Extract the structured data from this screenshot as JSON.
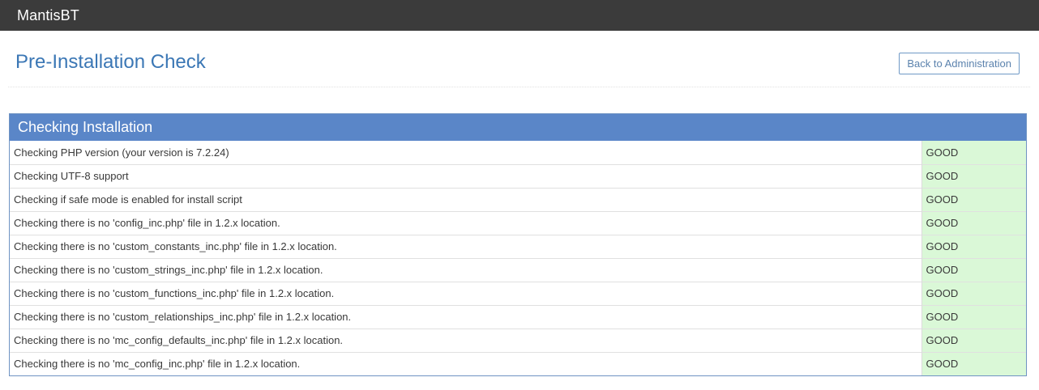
{
  "navbar": {
    "brand": "MantisBT"
  },
  "header": {
    "title": "Pre-Installation Check",
    "back_button": "Back to Administration"
  },
  "checks": {
    "title": "Checking Installation",
    "rows": [
      {
        "label": "Checking PHP version (your version is 7.2.24)",
        "status": "GOOD"
      },
      {
        "label": "Checking UTF-8 support",
        "status": "GOOD"
      },
      {
        "label": "Checking if safe mode is enabled for install script",
        "status": "GOOD"
      },
      {
        "label": "Checking there is no 'config_inc.php' file in 1.2.x location.",
        "status": "GOOD"
      },
      {
        "label": "Checking there is no 'custom_constants_inc.php' file in 1.2.x location.",
        "status": "GOOD"
      },
      {
        "label": "Checking there is no 'custom_strings_inc.php' file in 1.2.x location.",
        "status": "GOOD"
      },
      {
        "label": "Checking there is no 'custom_functions_inc.php' file in 1.2.x location.",
        "status": "GOOD"
      },
      {
        "label": "Checking there is no 'custom_relationships_inc.php' file in 1.2.x location.",
        "status": "GOOD"
      },
      {
        "label": "Checking there is no 'mc_config_defaults_inc.php' file in 1.2.x location.",
        "status": "GOOD"
      },
      {
        "label": "Checking there is no 'mc_config_inc.php' file in 1.2.x location.",
        "status": "GOOD"
      }
    ]
  },
  "colors": {
    "navbar_bg": "#3b3b3b",
    "title_blue": "#3b77b5",
    "widget_header_bg": "#5a86c8",
    "good_bg": "#daf8d7"
  }
}
